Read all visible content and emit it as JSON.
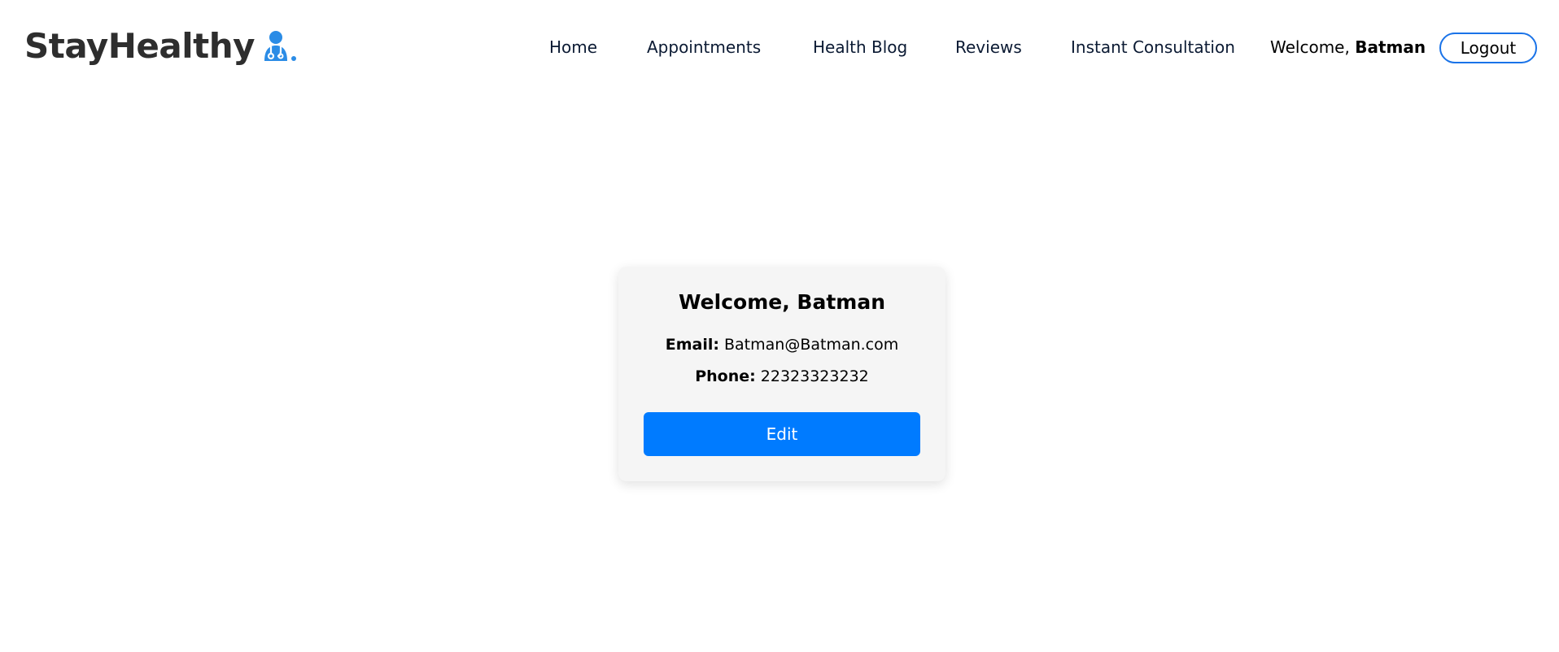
{
  "brand": {
    "name": "StayHealthy",
    "icon": "doctor-icon",
    "icon_color": "#2b8ce6"
  },
  "nav": {
    "items": [
      {
        "label": "Home"
      },
      {
        "label": "Appointments"
      },
      {
        "label": "Health Blog"
      },
      {
        "label": "Reviews"
      },
      {
        "label": "Instant Consultation"
      }
    ],
    "welcome_prefix": "Welcome,",
    "welcome_name": "Batman",
    "logout_label": "Logout"
  },
  "profile": {
    "heading": "Welcome, Batman",
    "email_label": "Email:",
    "email_value": "Batman@Batman.com",
    "phone_label": "Phone:",
    "phone_value": "22323323232",
    "edit_label": "Edit"
  },
  "colors": {
    "accent": "#007bff",
    "logout_border": "#1a73e8",
    "card_bg": "#f5f5f5"
  }
}
